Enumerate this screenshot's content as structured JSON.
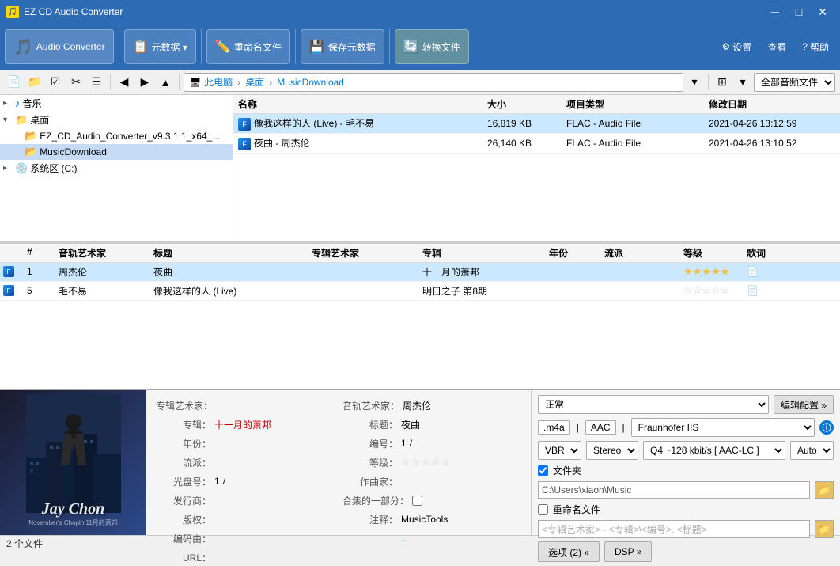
{
  "titleBar": {
    "title": "EZ CD Audio Converter",
    "minBtn": "─",
    "maxBtn": "□",
    "closeBtn": "✕"
  },
  "toolbar": {
    "audioConverterLabel": "Audio Converter",
    "metadataBtn": "元数据 ▾",
    "renameBtn": "重命名文件",
    "saveMetaBtn": "保存元数据",
    "convertBtn": "转换文件",
    "settingsBtn": "设置",
    "viewBtn": "查看",
    "helpBtn": "帮助"
  },
  "secToolbar": {
    "addressParts": [
      "此电脑",
      "桌面",
      "MusicDownload"
    ],
    "fileTypeFilter": "全部音频文件"
  },
  "fileList": {
    "headers": [
      "名称",
      "大小",
      "项目类型",
      "修改日期"
    ],
    "rows": [
      {
        "name": "像我这样的人 (Live) - 毛不易",
        "size": "16,819 KB",
        "type": "FLAC - Audio File",
        "date": "2021-04-26 13:12:59"
      },
      {
        "name": "夜曲 - 周杰伦",
        "size": "26,140 KB",
        "type": "FLAC - Audio File",
        "date": "2021-04-26 13:10:52"
      }
    ]
  },
  "fileTree": {
    "items": [
      {
        "indent": 0,
        "label": "♪ 音乐",
        "icon": "music",
        "expanded": false
      },
      {
        "indent": 0,
        "label": "▾ 桌面",
        "icon": "folder",
        "expanded": true
      },
      {
        "indent": 1,
        "label": "EZ_CD_Audio_Converter_v9.3.1.1_x64_...",
        "icon": "folder"
      },
      {
        "indent": 1,
        "label": "MusicDownload",
        "icon": "folder",
        "selected": true
      },
      {
        "indent": 0,
        "label": "▸ 系统区 (C:)",
        "icon": "drive"
      }
    ]
  },
  "trackList": {
    "headers": [
      "",
      "#",
      "音轨艺术家",
      "标题",
      "专辑艺术家",
      "专辑",
      "年份",
      "流派",
      "等级",
      "歌词"
    ],
    "rows": [
      {
        "selected": true,
        "num": "1",
        "artist": "周杰伦",
        "title": "夜曲",
        "albumArtist": "",
        "album": "十一月的萧邦",
        "year": "",
        "genre": "",
        "rating": "★★★★★",
        "lyrics": "📄"
      },
      {
        "selected": false,
        "num": "5",
        "artist": "毛不易",
        "title": "像我这样的人 (Live)",
        "albumArtist": "",
        "album": "明日之子 第8期",
        "year": "",
        "genre": "",
        "rating": "☆☆☆☆☆",
        "lyrics": "📄"
      }
    ]
  },
  "metadata": {
    "albumArtistLabel": "专辑艺术家：",
    "albumArtistValue": "",
    "albumLabel": "专辑：",
    "albumValue": "十一月的萧邦",
    "yearLabel": "年份：",
    "yearValue": "",
    "genreLabel": "流派：",
    "genreValue": "",
    "discLabel": "光盘号：",
    "discValue": "1",
    "discSep": "/",
    "publisherLabel": "发行商：",
    "publisherValue": "",
    "copyrightLabel": "版权：",
    "copyrightValue": "",
    "encodedByLabel": "编码由：",
    "encodedByValue": "",
    "urlLabel": "URL：",
    "urlValue": "",
    "trackArtistLabel": "音轨艺术家：",
    "trackArtistValue": "周杰伦",
    "titleLabel": "标题：",
    "titleValue": "夜曲",
    "trackNumLabel": "编号：",
    "trackNumValue": "1",
    "trackNumSep": "/",
    "ratingLabel": "等级：",
    "ratingValue": "☆☆☆☆☆",
    "composerLabel": "作曲家：",
    "composerValue": "",
    "partOfLabel": "合集的一部分：",
    "partOfValue": false,
    "commentLabel": "注释：",
    "commentValue": "MusicTools",
    "moreLabel": "..."
  },
  "albumArt": {
    "artistText": "Jay Chon",
    "subText": "November's Chopin 11月的萧邦"
  },
  "config": {
    "modeLabel": "正常",
    "editConfigBtn": "编辑配置 »",
    "formatTag": ".m4a",
    "codecPart1": "AAC",
    "codecPart2": "Fraunhofer IIS",
    "infoBtn": "ⓘ",
    "vbrLabel": "VBR",
    "stereoLabel": "Stereo",
    "qualityLabel": "Q4 ~128 kbit/s [ AAC-LC ]",
    "autoLabel": "Auto",
    "folderCheckLabel": "文件夹",
    "folderPath": "C:\\Users\\xiaoh\\Music",
    "renameCheckLabel": "重命名文件",
    "renamePattern": "<专辑艺术家> - <专辑>\\<编号>. <标题>",
    "optionsBtn": "选项 (2) »",
    "dspBtn": "DSP »"
  },
  "statusBar": {
    "text": "2 个文件"
  }
}
